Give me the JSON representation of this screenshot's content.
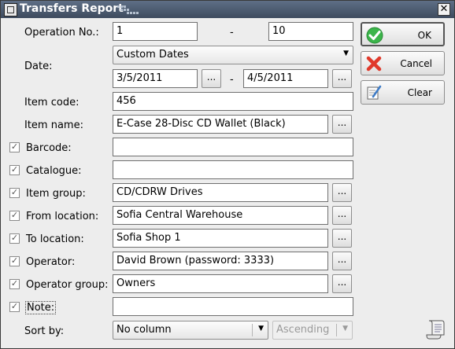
{
  "window": {
    "title": "Transfers Report",
    "close_label": "✕"
  },
  "fields": {
    "operation_no_label": "Operation No.:",
    "operation_from": "1",
    "operation_to": "10",
    "range_dash": "-",
    "date_label": "Date:",
    "date_mode": "Custom Dates",
    "date_from": "3/5/2011",
    "date_to": "4/5/2011",
    "item_code_label": "Item code:",
    "item_code": "456",
    "item_name_label": "Item name:",
    "item_name": "E-Case 28-Disc CD Wallet (Black)",
    "barcode_label": "Barcode:",
    "barcode": "",
    "catalogue_label": "Catalogue:",
    "catalogue": "",
    "item_group_label": "Item group:",
    "item_group": "CD/CDRW Drives",
    "from_location_label": "From location:",
    "from_location": "Sofia Central Warehouse",
    "to_location_label": "To location:",
    "to_location": "Sofia Shop 1",
    "operator_label": "Operator:",
    "operator": "David Brown (password: 3333)",
    "operator_group_label": "Operator group:",
    "operator_group": "Owners",
    "note_label": "Note:",
    "note": "",
    "sort_by_label": "Sort by:",
    "sort_column": "No column",
    "sort_direction": "Ascending",
    "ellipsis": "...",
    "check_mark": "✓",
    "dropdown_arrow": "▼"
  },
  "buttons": {
    "ok": "OK",
    "cancel": "Cancel",
    "clear": "Clear"
  },
  "colors": {
    "titlebar": "#4a586e",
    "ok_icon": "#3bb54a",
    "cancel_icon": "#e0392b"
  }
}
